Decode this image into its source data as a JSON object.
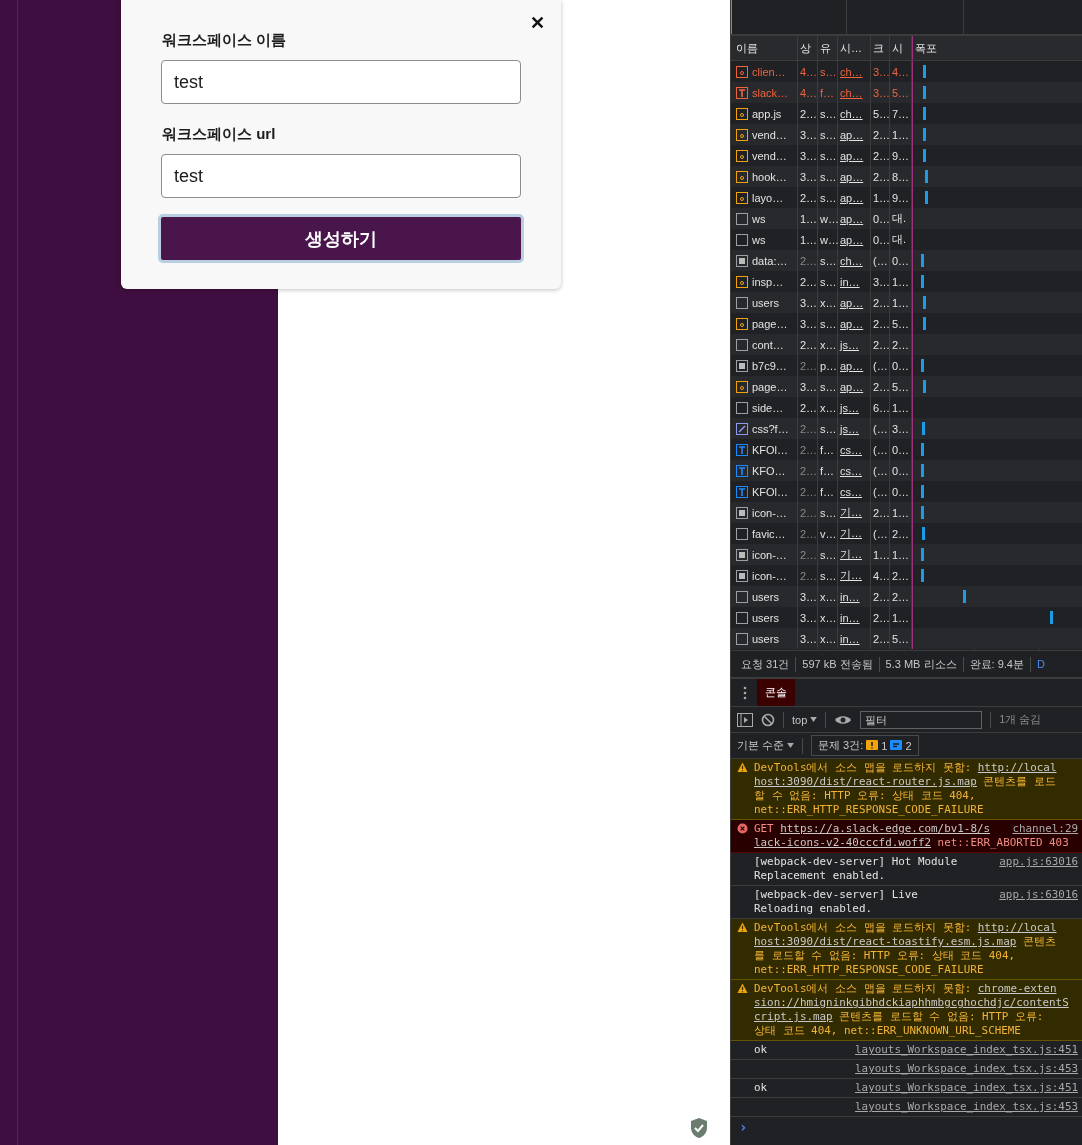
{
  "dialog": {
    "fields": [
      {
        "label": "워크스페이스 이름",
        "value": "test"
      },
      {
        "label": "워크스페이스 **url**",
        "value": "test"
      }
    ],
    "submit": "생성하기",
    "close": "✕"
  },
  "network": {
    "columns": [
      "이름",
      "상",
      "유",
      "시…",
      "크",
      "시",
      "폭포"
    ],
    "rows": [
      {
        "kind": "script",
        "failed": true,
        "cached": false,
        "cells": [
          "clien…",
          "4…",
          "s…",
          "ch…",
          "3…",
          "4…"
        ]
      },
      {
        "kind": "font",
        "failed": true,
        "cached": false,
        "cells": [
          "slack…",
          "4…",
          "f…",
          "ch…",
          "3…",
          "5…"
        ]
      },
      {
        "kind": "script",
        "failed": false,
        "cached": false,
        "cells": [
          "app.js",
          "2…",
          "s…",
          "ch…",
          "5…",
          "7…"
        ]
      },
      {
        "kind": "script",
        "failed": false,
        "cached": false,
        "cells": [
          "vend…",
          "3…",
          "s…",
          "ap…",
          "2…",
          "1…"
        ]
      },
      {
        "kind": "script",
        "failed": false,
        "cached": false,
        "cells": [
          "vend…",
          "3…",
          "s…",
          "ap…",
          "2…",
          "9…"
        ]
      },
      {
        "kind": "script",
        "failed": false,
        "cached": false,
        "cells": [
          "hook…",
          "3…",
          "s…",
          "ap…",
          "2…",
          "8…"
        ]
      },
      {
        "kind": "script",
        "failed": false,
        "cached": false,
        "cells": [
          "layo…",
          "2…",
          "s…",
          "ap…",
          "1…",
          "9…"
        ]
      },
      {
        "kind": "document",
        "failed": false,
        "cached": false,
        "cells": [
          "ws",
          "1…",
          "w…",
          "ap…",
          "0…",
          "대."
        ]
      },
      {
        "kind": "document",
        "failed": false,
        "cached": false,
        "cells": [
          "ws",
          "1…",
          "w…",
          "ap…",
          "0…",
          "대."
        ]
      },
      {
        "kind": "image",
        "failed": false,
        "cached": true,
        "cells": [
          "data:…",
          "2…",
          "s…",
          "ch…",
          "(…",
          "0…"
        ]
      },
      {
        "kind": "script",
        "failed": false,
        "cached": false,
        "cells": [
          "insp…",
          "2…",
          "s…",
          "in…",
          "3…",
          "1…"
        ]
      },
      {
        "kind": "document",
        "failed": false,
        "cached": false,
        "cells": [
          "users",
          "3…",
          "x…",
          "ap…",
          "2…",
          "1…"
        ]
      },
      {
        "kind": "script",
        "failed": false,
        "cached": false,
        "cells": [
          "page…",
          "3…",
          "s…",
          "ap…",
          "2…",
          "5…"
        ]
      },
      {
        "kind": "document",
        "failed": false,
        "cached": false,
        "cells": [
          "cont…",
          "2…",
          "x…",
          "js…",
          "2…",
          "2…"
        ]
      },
      {
        "kind": "image",
        "failed": false,
        "cached": true,
        "cells": [
          "b7c9…",
          "2…",
          "p…",
          "ap…",
          "(…",
          "0…"
        ]
      },
      {
        "kind": "script",
        "failed": false,
        "cached": false,
        "cells": [
          "page…",
          "3…",
          "s…",
          "ap…",
          "2…",
          "5…"
        ]
      },
      {
        "kind": "document",
        "failed": false,
        "cached": false,
        "cells": [
          "side…",
          "2…",
          "x…",
          "js…",
          "6…",
          "1…"
        ]
      },
      {
        "kind": "stylesheet",
        "failed": false,
        "cached": true,
        "cells": [
          "css?f…",
          "2…",
          "s…",
          "js…",
          "(…",
          "3…"
        ]
      },
      {
        "kind": "font",
        "failed": false,
        "cached": true,
        "cells": [
          "KFOl…",
          "2…",
          "f…",
          "cs…",
          "(…",
          "0…"
        ]
      },
      {
        "kind": "font",
        "failed": false,
        "cached": true,
        "cells": [
          "KFO…",
          "2…",
          "f…",
          "cs…",
          "(…",
          "0…"
        ]
      },
      {
        "kind": "font",
        "failed": false,
        "cached": true,
        "cells": [
          "KFOl…",
          "2…",
          "f…",
          "cs…",
          "(…",
          "0…"
        ]
      },
      {
        "kind": "image",
        "failed": false,
        "cached": true,
        "cells": [
          "icon-…",
          "2…",
          "s…",
          "기…",
          "2…",
          "1…"
        ]
      },
      {
        "kind": "document",
        "failed": false,
        "cached": true,
        "cells": [
          "favic…",
          "2…",
          "v…",
          "기…",
          "(…",
          "2…"
        ]
      },
      {
        "kind": "image",
        "failed": false,
        "cached": true,
        "cells": [
          "icon-…",
          "2…",
          "s…",
          "기…",
          "1…",
          "1…"
        ]
      },
      {
        "kind": "image",
        "failed": false,
        "cached": true,
        "cells": [
          "icon-…",
          "2…",
          "s…",
          "기…",
          "4…",
          "2…"
        ]
      },
      {
        "kind": "document",
        "failed": false,
        "cached": false,
        "cells": [
          "users",
          "3…",
          "x…",
          "in…",
          "2…",
          "2…"
        ]
      },
      {
        "kind": "document",
        "failed": false,
        "cached": false,
        "cells": [
          "users",
          "3…",
          "x…",
          "in…",
          "2…",
          "1…"
        ]
      },
      {
        "kind": "document",
        "failed": false,
        "cached": false,
        "cells": [
          "users",
          "3…",
          "x…",
          "in…",
          "2…",
          "5…"
        ]
      }
    ],
    "summary": [
      "요청 31건",
      "597 kB 전송됨",
      "5.3 MB 리소스",
      "완료: 9.4분",
      "D"
    ]
  },
  "console": {
    "tabs": [
      {
        "label": "콘솔",
        "selected": true
      }
    ],
    "context": "top",
    "filter_placeholder": "필터",
    "hidden": "1개 숨김",
    "levels": "기본 수준",
    "issues": {
      "label": "문제 3건:",
      "warnings": "1",
      "infos": "2"
    },
    "messages": [
      {
        "kind": "warning",
        "lines": [
          [
            {
              "text": "DevTools에서 소스 맵을 로드하지 못함: ",
              "link": false
            },
            {
              "text": "http://local",
              "link": true
            }
          ],
          [
            {
              "text": "host:3090/dist/react-router.js.map",
              "link": true
            },
            {
              "text": " 콘텐츠를 로드",
              "link": false
            }
          ],
          [
            {
              "text": "할 수 없음: HTTP 오류: 상태 코드 404,",
              "link": false
            }
          ],
          [
            {
              "text": "net::ERR_HTTP_RESPONSE_CODE_FAILURE",
              "link": false
            }
          ]
        ]
      },
      {
        "kind": "error",
        "source": "channel:29",
        "lines": [
          [
            {
              "text": "GET ",
              "link": false
            },
            {
              "text": "https://a.slack-edge.com/bv1-8/s",
              "link": true
            }
          ],
          [
            {
              "text": "lack-icons-v2-40cccfd.woff2",
              "link": true
            },
            {
              "text": " net::ERR_ABORTED 403",
              "link": false
            }
          ]
        ]
      },
      {
        "kind": "info",
        "source": "app.js:63016",
        "lines": [
          [
            {
              "text": "[webpack-dev-server] Hot Module",
              "link": false
            }
          ],
          [
            {
              "text": "Replacement enabled.",
              "link": false
            }
          ]
        ]
      },
      {
        "kind": "info",
        "source": "app.js:63016",
        "lines": [
          [
            {
              "text": "[webpack-dev-server] Live",
              "link": false
            }
          ],
          [
            {
              "text": "Reloading enabled.",
              "link": false
            }
          ]
        ]
      },
      {
        "kind": "warning",
        "lines": [
          [
            {
              "text": "DevTools에서 소스 맵을 로드하지 못함: ",
              "link": false
            },
            {
              "text": "http://local",
              "link": true
            }
          ],
          [
            {
              "text": "host:3090/dist/react-toastify.esm.js.map",
              "link": true
            },
            {
              "text": " 콘텐츠",
              "link": false
            }
          ],
          [
            {
              "text": "를 로드할 수 없음: HTTP 오류: 상태 코드 404,",
              "link": false
            }
          ],
          [
            {
              "text": "net::ERR_HTTP_RESPONSE_CODE_FAILURE",
              "link": false
            }
          ]
        ]
      },
      {
        "kind": "warning",
        "lines": [
          [
            {
              "text": "DevTools에서 소스 맵을 로드하지 못함: ",
              "link": false
            },
            {
              "text": "chrome-exten",
              "link": true
            }
          ],
          [
            {
              "text": "sion://hmigninkgibhdckiaphhmbgcghochdjc/contentS",
              "link": true
            }
          ],
          [
            {
              "text": "cript.js.map",
              "link": true
            },
            {
              "text": " 콘텐츠를 로드할 수 없음: HTTP 오류:",
              "link": false
            }
          ],
          [
            {
              "text": "상태 코드 404, net::ERR_UNKNOWN_URL_SCHEME",
              "link": false
            }
          ]
        ]
      },
      {
        "kind": "log",
        "source": "layouts_Workspace_index_tsx.js:451",
        "lines": [
          [
            {
              "text": "ok",
              "link": false
            }
          ]
        ]
      },
      {
        "kind": "log",
        "source": "layouts_Workspace_index_tsx.js:453"
      },
      {
        "kind": "log",
        "source": "layouts_Workspace_index_tsx.js:451",
        "lines": [
          [
            {
              "text": "ok",
              "link": false
            }
          ]
        ]
      },
      {
        "kind": "log",
        "source": "layouts_Workspace_index_tsx.js:453"
      }
    ],
    "prompt": "›"
  }
}
